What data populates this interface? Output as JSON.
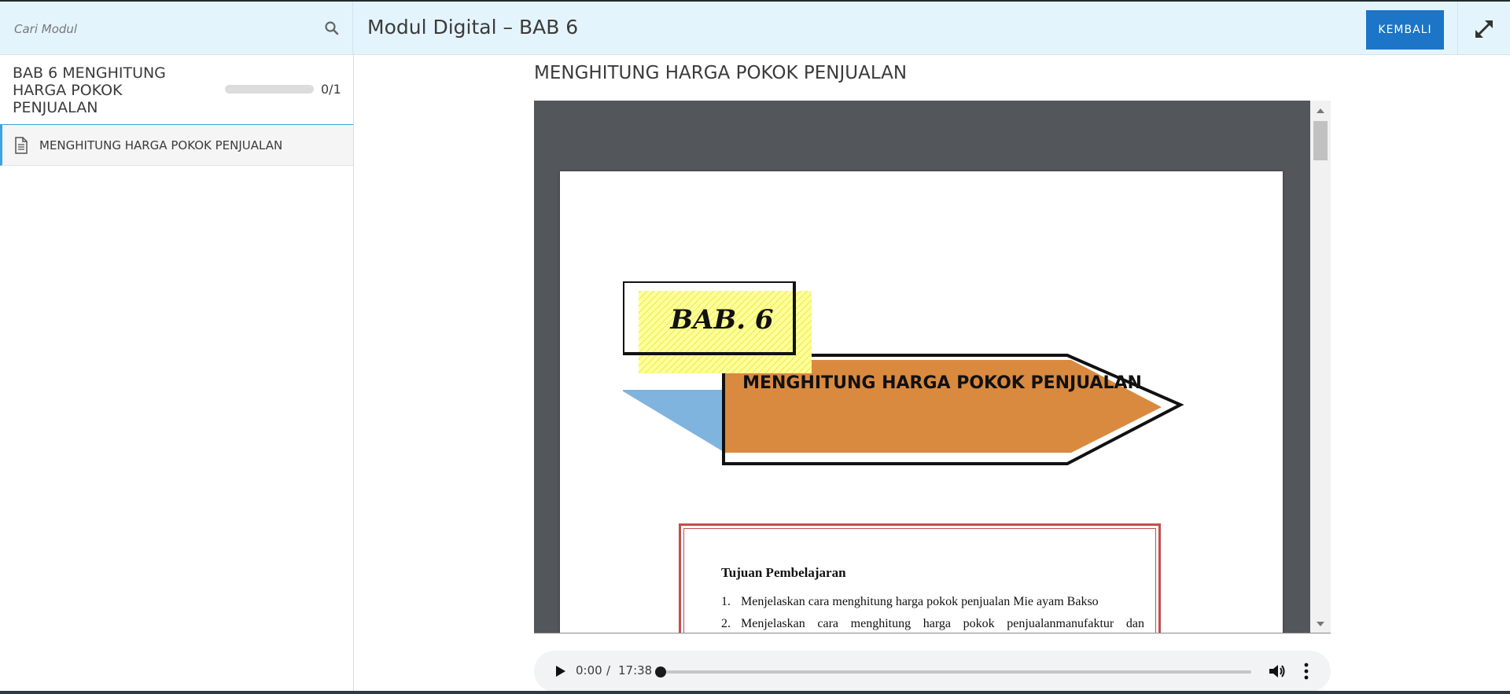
{
  "header": {
    "search_placeholder": "Cari Modul",
    "title": "Modul Digital – BAB 6",
    "back_label": "KEMBALI"
  },
  "sidebar": {
    "section_title": "BAB 6 MENGHITUNG HARGA POKOK PENJUALAN",
    "progress_count": "0/1",
    "progress_fraction": 0,
    "items": [
      {
        "label": "MENGHITUNG HARGA POKOK PENJUALAN",
        "icon": "document-icon"
      }
    ]
  },
  "content": {
    "title": "MENGHITUNG HARGA POKOK PENJUALAN",
    "document": {
      "chapter_label": "BAB. 6",
      "chapter_title": "MENGHITUNG HARGA POKOK PENJUALAN",
      "objectives_heading": "Tujuan Pembelajaran",
      "objectives": [
        {
          "num": "1.",
          "text": "Menjelaskan cara menghitung harga pokok penjualan Mie ayam Bakso"
        },
        {
          "num": "2.",
          "text": "Menjelaskan cara menghitung harga pokok penjualanmanufaktur dan"
        }
      ]
    }
  },
  "audio": {
    "current_time": "0:00",
    "separator": "/",
    "duration": "17:38",
    "position_fraction": 0
  },
  "colors": {
    "accent": "#1c75c6",
    "header_bg": "#e4f4fc",
    "viewer_bg": "#53575b",
    "banner_orange": "#d98a3f",
    "banner_blue": "#7fb4de",
    "objectives_border": "#c0504d"
  }
}
